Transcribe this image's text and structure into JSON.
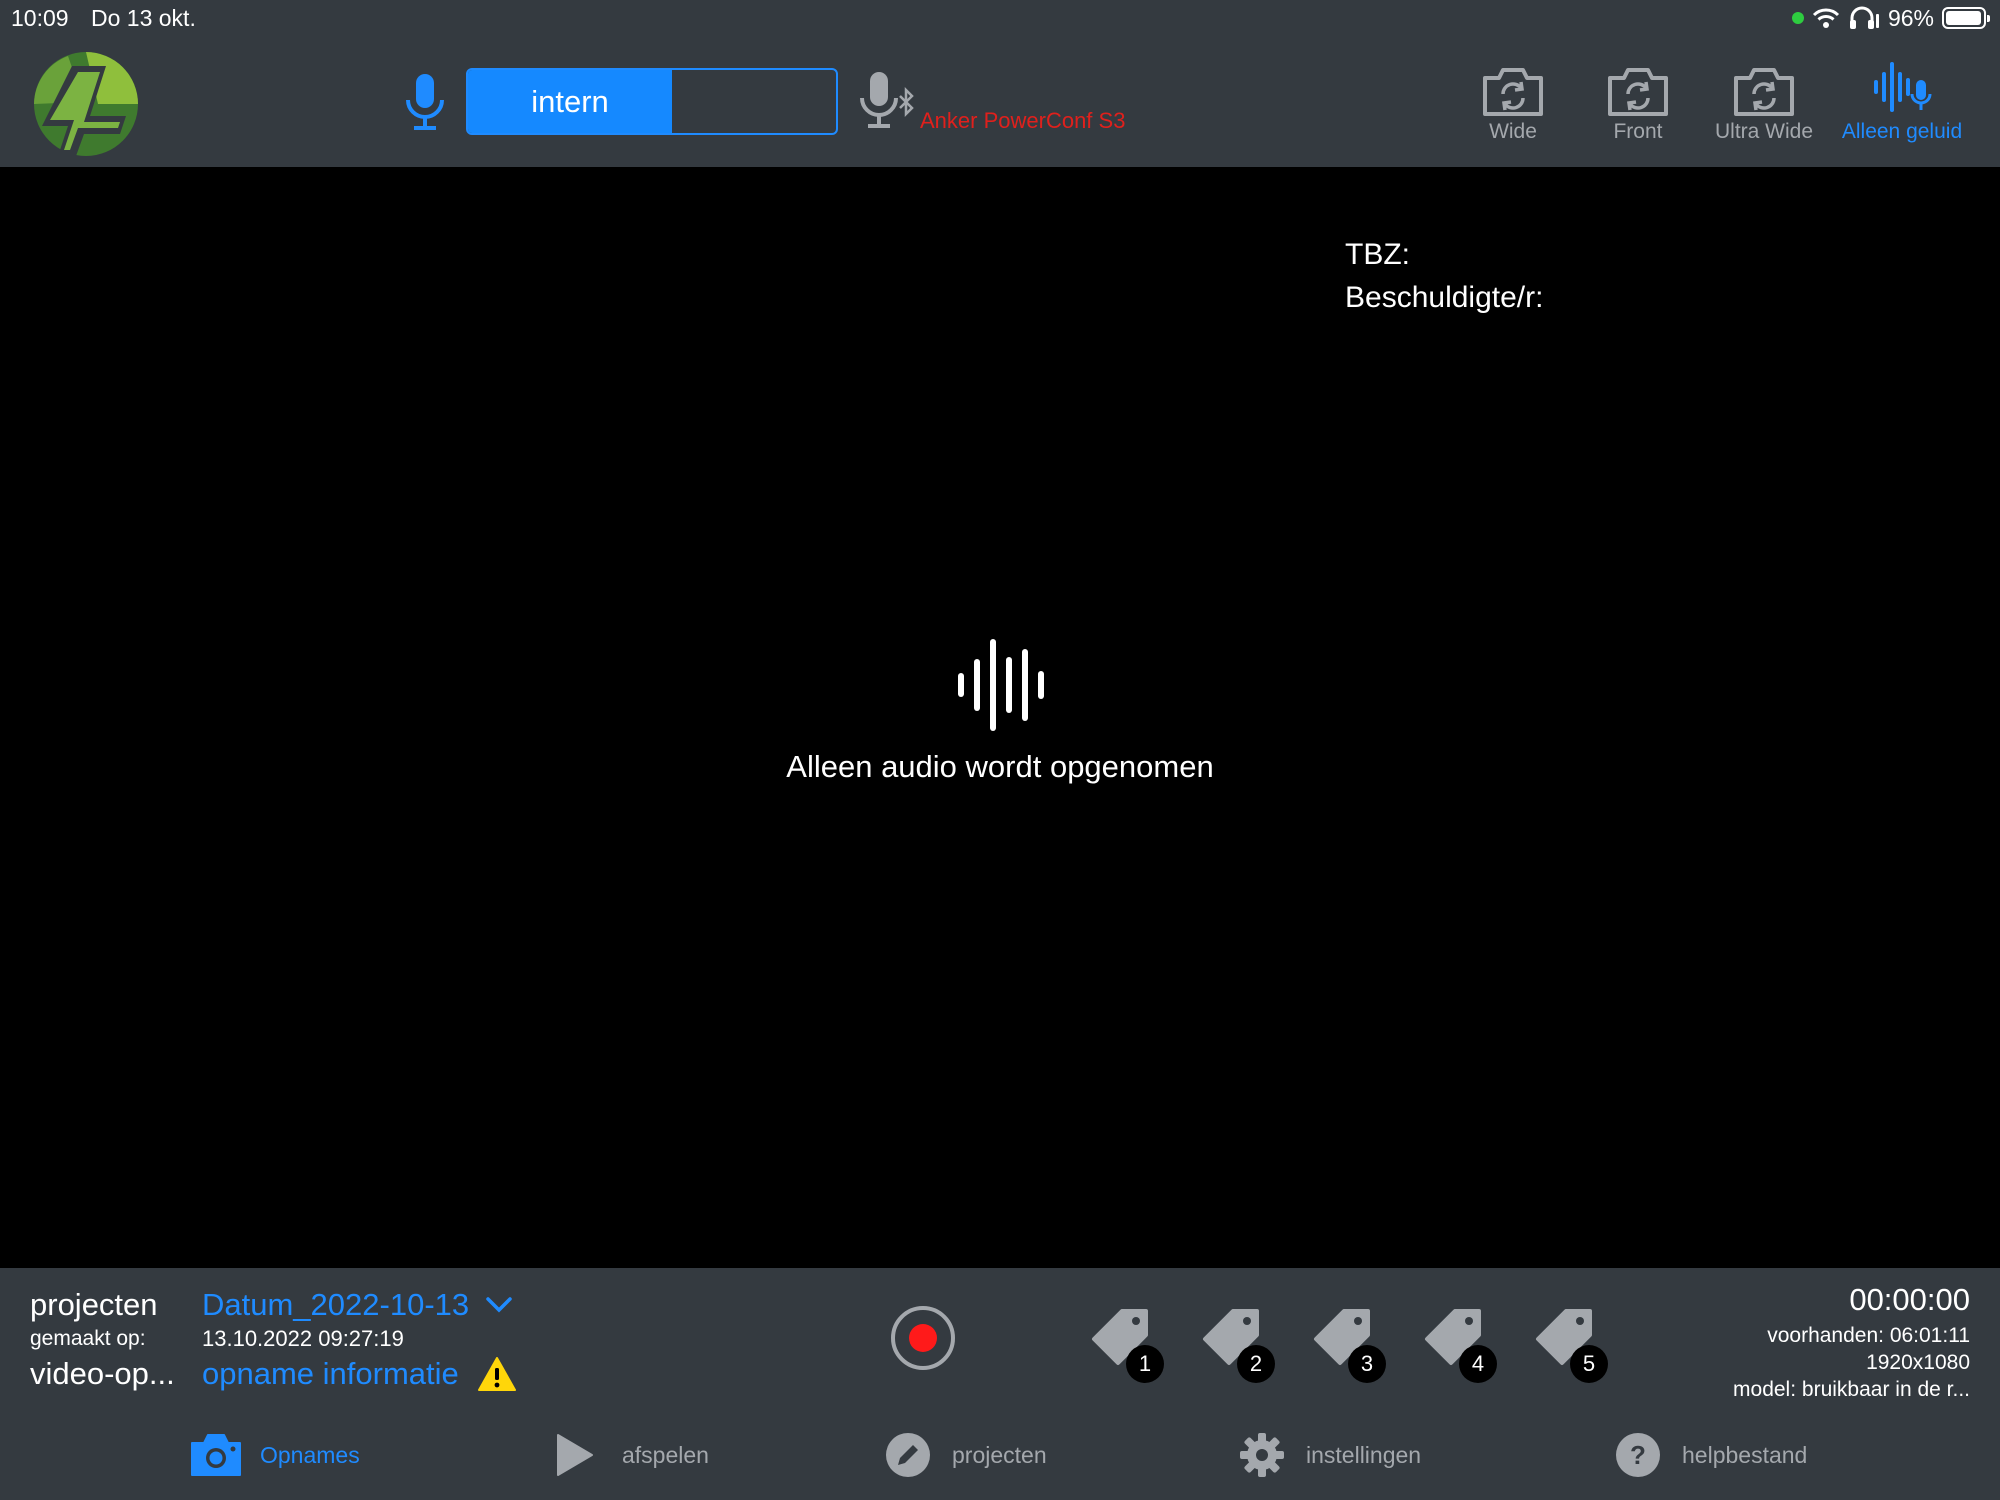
{
  "status_bar": {
    "time": "10:09",
    "date": "Do 13 okt.",
    "battery": "96%",
    "battery_fill": 0.96,
    "icons": [
      "green-dot",
      "wifi-icon",
      "headphones-icon",
      "battery-icon"
    ]
  },
  "audio_source": {
    "segments": [
      "intern",
      ""
    ],
    "selected": "intern",
    "external_device": "Anker PowerConf S3"
  },
  "camera_modes": [
    {
      "label": "Wide",
      "icon": "camera-switch-icon",
      "active": false
    },
    {
      "label": "Front",
      "icon": "camera-switch-icon",
      "active": false
    },
    {
      "label": "Ultra Wide",
      "icon": "camera-switch-icon",
      "active": false
    },
    {
      "label": "Alleen geluid",
      "icon": "audio-waveform-mic-icon",
      "active": true
    }
  ],
  "preview": {
    "overlay_lines": [
      "TBZ:",
      "Beschuldigte/r:"
    ],
    "message": "Alleen audio wordt opgenomen"
  },
  "info": {
    "projects_label": "projecten",
    "project_name": "Datum_2022-10-13",
    "created_label": "gemaakt op:",
    "created_value": "13.10.2022 09:27:19",
    "video_label": "video-op...",
    "recording_info_link": "opname informatie"
  },
  "tags": [
    "1",
    "2",
    "3",
    "4",
    "5"
  ],
  "recording": {
    "timer": "00:00:00",
    "available": "voorhanden: 06:01:11",
    "resolution": "1920x1080",
    "model": "model: bruikbaar in de r..."
  },
  "tabs": [
    {
      "label": "Opnames",
      "icon": "camera-icon",
      "active": true
    },
    {
      "label": "afspelen",
      "icon": "play-icon",
      "active": false
    },
    {
      "label": "projecten",
      "icon": "pencil-icon",
      "active": false
    },
    {
      "label": "instellingen",
      "icon": "gear-icon",
      "active": false
    },
    {
      "label": "helpbestand",
      "icon": "help-icon",
      "active": false
    }
  ],
  "colors": {
    "bar_bg": "#343a40",
    "accent": "#1f8bff",
    "muted": "#a4a8ad",
    "record": "#ff1a1a",
    "device_warning": "#e0201c",
    "warning_yellow": "#ffd60a"
  }
}
